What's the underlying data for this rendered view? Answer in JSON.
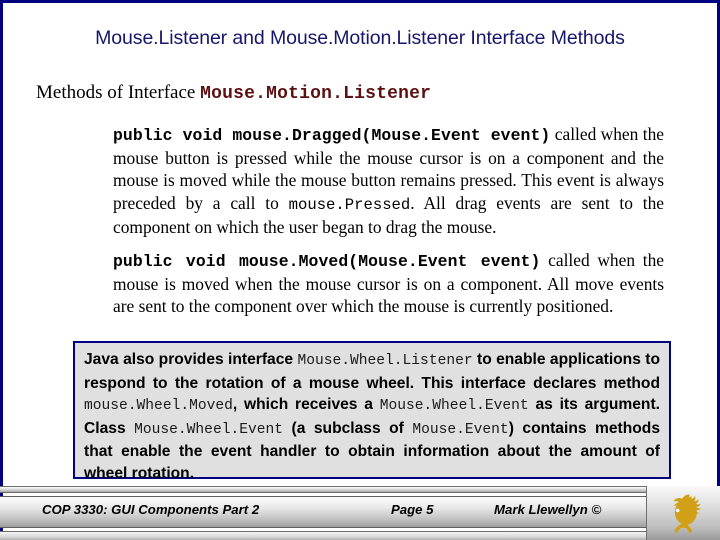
{
  "slide": {
    "title": "Mouse.Listener and Mouse.Motion.Listener Interface Methods",
    "subtitle_prefix": "Methods of Interface ",
    "subtitle_code": "Mouse.Motion.Listener",
    "border_color": "#000080",
    "title_color": "#16176b",
    "code_red_color": "#5c1111"
  },
  "paragraphs": [
    {
      "signature": "public void mouse.Dragged(Mouse.Event event)",
      "text_before_code": " called when the mouse button is pressed while the mouse cursor is on a component and the mouse is moved while the mouse button remains pressed.  This event is always preceded by a call to ",
      "inline_code": "mouse.Pressed",
      "text_after_code": ".  All drag events are sent to the component on which the user began to drag the mouse."
    },
    {
      "signature": "public void mouse.Moved(Mouse.Event event)",
      "text_before_code": " called when the mouse is moved when the mouse cursor is on a component.  All move events are sent to the component over which the mouse is currently positioned.",
      "inline_code": "",
      "text_after_code": ""
    }
  ],
  "callout": {
    "seg1": "Java also provides interface ",
    "code1": "Mouse.Wheel.Listener",
    "seg2": " to enable applications to respond to the rotation of a mouse wheel.  This interface declares method ",
    "code2": "mouse.Wheel.Moved",
    "seg3": ", which receives a ",
    "code3": "Mouse.Wheel.Event",
    "seg4": " as its argument.  Class ",
    "code4": "Mouse.Wheel.Event",
    "seg5": " (a subclass of ",
    "code5": "Mouse.Event",
    "seg6": ") contains methods that enable the event handler to obtain information about the amount of wheel rotation.",
    "border_color": "#000080",
    "background_color": "#e0e0e0"
  },
  "footer": {
    "left": "COP 3330: GUI Components Part 2",
    "center": "Page 5",
    "right": "Mark Llewellyn ©",
    "logo_name": "ucf-pegasus-logo",
    "logo_color": "#d2a017"
  }
}
